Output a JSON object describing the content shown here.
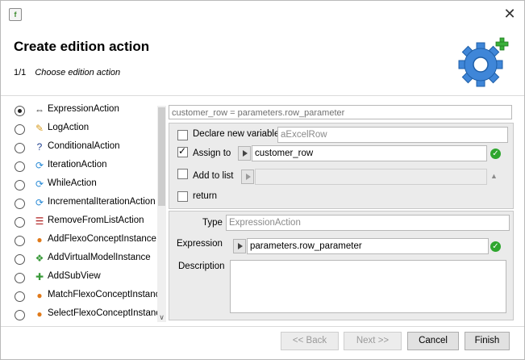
{
  "window": {
    "app_icon": "flexo-app-icon",
    "close": "✕"
  },
  "header": {
    "title": "Create edition action",
    "step_index": "1/1",
    "step_label": "Choose edition action",
    "logo": "gear-plus-icon"
  },
  "actions": [
    {
      "label": "ExpressionAction",
      "icon": "⇔",
      "icon_name": "expression-icon",
      "color": "#333333",
      "selected": true
    },
    {
      "label": "LogAction",
      "icon": "✎",
      "icon_name": "pencil-icon",
      "color": "#d79b1e",
      "selected": false
    },
    {
      "label": "ConditionalAction",
      "icon": "?",
      "icon_name": "question-icon",
      "color": "#1f3f8f",
      "selected": false
    },
    {
      "label": "IterationAction",
      "icon": "⟳",
      "icon_name": "loop-icon",
      "color": "#2a8bd6",
      "selected": false
    },
    {
      "label": "WhileAction",
      "icon": "⟳",
      "icon_name": "loop-icon",
      "color": "#2a8bd6",
      "selected": false
    },
    {
      "label": "IncrementalIterationAction",
      "icon": "⟳",
      "icon_name": "loop-icon",
      "color": "#2a8bd6",
      "selected": false
    },
    {
      "label": "RemoveFromListAction",
      "icon": "☰",
      "icon_name": "list-remove-icon",
      "color": "#b02020",
      "selected": false
    },
    {
      "label": "AddFlexoConceptInstance",
      "icon": "●",
      "icon_name": "concept-add-icon",
      "color": "#e07a1a",
      "selected": false
    },
    {
      "label": "AddVirtualModelInstance",
      "icon": "❖",
      "icon_name": "model-add-icon",
      "color": "#3a9a3a",
      "selected": false
    },
    {
      "label": "AddSubView",
      "icon": "✚",
      "icon_name": "subview-add-icon",
      "color": "#3a9a3a",
      "selected": false
    },
    {
      "label": "MatchFlexoConceptInstance",
      "icon": "●",
      "icon_name": "concept-match-icon",
      "color": "#e07a1a",
      "selected": false
    },
    {
      "label": "SelectFlexoConceptInstance",
      "icon": "●",
      "icon_name": "concept-select-icon",
      "color": "#e07a1a",
      "selected": false
    }
  ],
  "editor": {
    "expression_summary": "customer_row = parameters.row_parameter",
    "declare_variable": {
      "label": "Declare new variable",
      "checked": false,
      "placeholder": "aExcelRow"
    },
    "assign_to": {
      "label": "Assign to",
      "checked": true,
      "value": "customer_row"
    },
    "add_to_list": {
      "label": "Add to list",
      "checked": false,
      "value": ""
    },
    "return": {
      "label": "return",
      "checked": false
    },
    "type": {
      "label": "Type",
      "placeholder": "ExpressionAction"
    },
    "expression": {
      "label": "Expression",
      "value": "parameters.row_parameter"
    },
    "description": {
      "label": "Description",
      "value": ""
    }
  },
  "buttons": {
    "back": "<< Back",
    "next": "Next >>",
    "cancel": "Cancel",
    "finish": "Finish"
  },
  "colors": {
    "accent": "#2b7bd8",
    "valid": "#2fa62f",
    "panel": "#ebebeb"
  }
}
